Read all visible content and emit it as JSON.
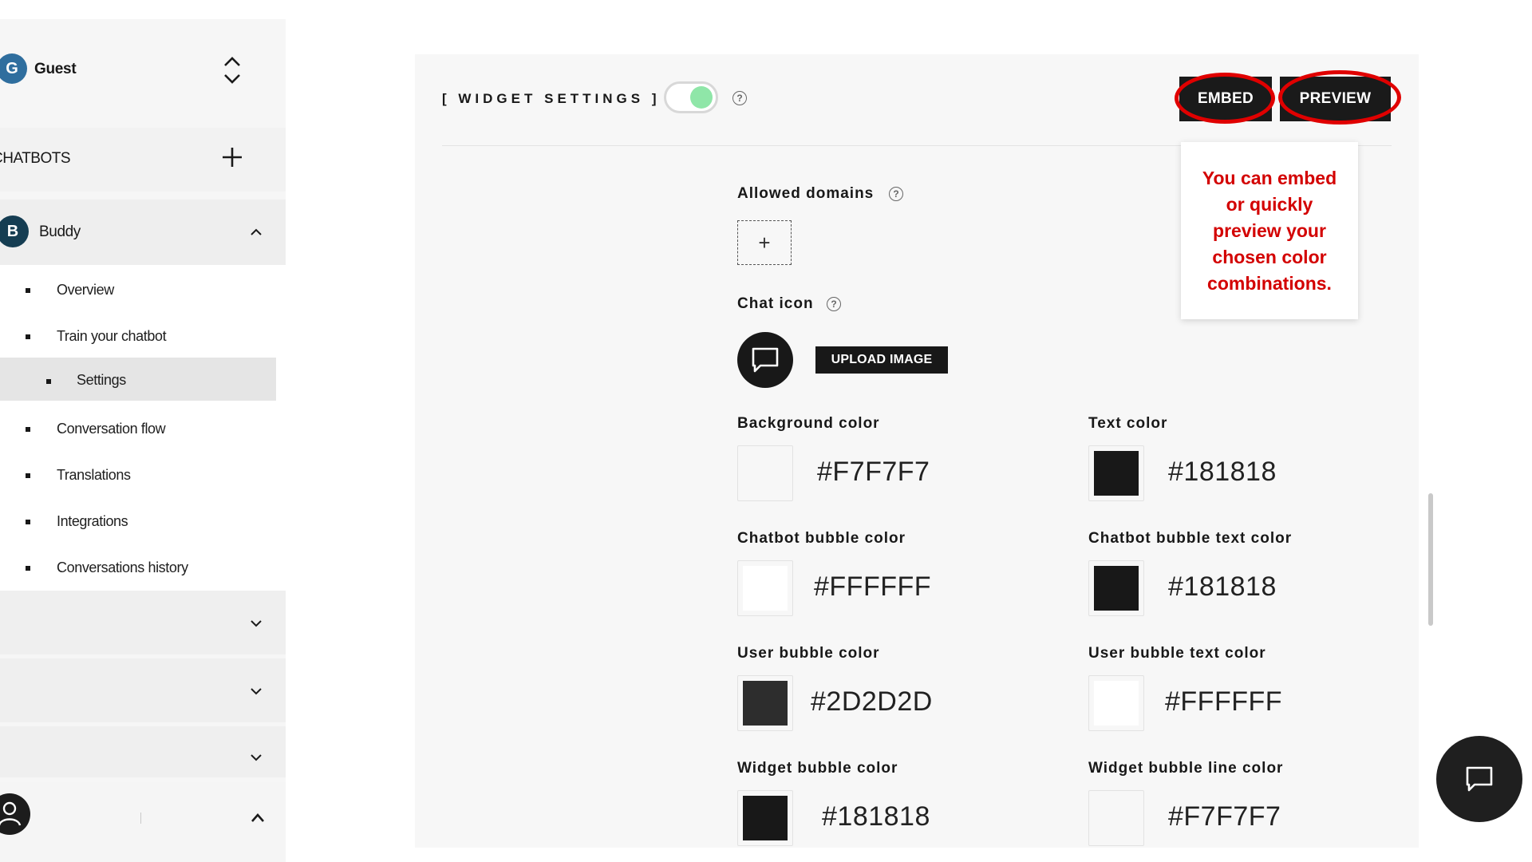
{
  "sidebar": {
    "user": {
      "initial": "G",
      "name": "Guest"
    },
    "chatbots_section": {
      "title": "CHATBOTS"
    },
    "bot": {
      "initial": "B",
      "name": "Buddy"
    },
    "menu_items": [
      {
        "label": "Overview"
      },
      {
        "label": "Train your chatbot"
      },
      {
        "label": "Settings"
      },
      {
        "label": "Conversation flow"
      },
      {
        "label": "Translations"
      },
      {
        "label": "Integrations"
      },
      {
        "label": "Conversations history"
      }
    ],
    "active_item": "Settings"
  },
  "panel": {
    "title": "[ WIDGET SETTINGS ]",
    "toggle_on": true,
    "help_glyph": "?",
    "embed_label": "EMBED",
    "preview_label": "PREVIEW",
    "tooltip": "You can embed or quickly preview your chosen color combinations.",
    "allowed_domains_label": "Allowed domains",
    "add_glyph": "+",
    "chat_icon_label": "Chat icon",
    "upload_label": "UPLOAD IMAGE",
    "colors": [
      {
        "label": "Background color",
        "hex": "#F7F7F7",
        "swatch": "#F7F7F7"
      },
      {
        "label": "Text color",
        "hex": "#181818",
        "swatch": "#181818"
      },
      {
        "label": "Chatbot bubble color",
        "hex": "#FFFFFF",
        "swatch": "#FFFFFF"
      },
      {
        "label": "Chatbot bubble text color",
        "hex": "#181818",
        "swatch": "#181818"
      },
      {
        "label": "User bubble color",
        "hex": "#2D2D2D",
        "swatch": "#2D2D2D"
      },
      {
        "label": "User bubble text color",
        "hex": "#FFFFFF",
        "swatch": "#FFFFFF"
      },
      {
        "label": "Widget bubble color",
        "hex": "#181818",
        "swatch": "#181818"
      },
      {
        "label": "Widget bubble line color",
        "hex": "#F7F7F7",
        "swatch": "#F7F7F7"
      }
    ]
  },
  "theme": {
    "accent_toggle": "#8FE6A8",
    "annotation_red": "#D30000",
    "dark": "#181818"
  }
}
